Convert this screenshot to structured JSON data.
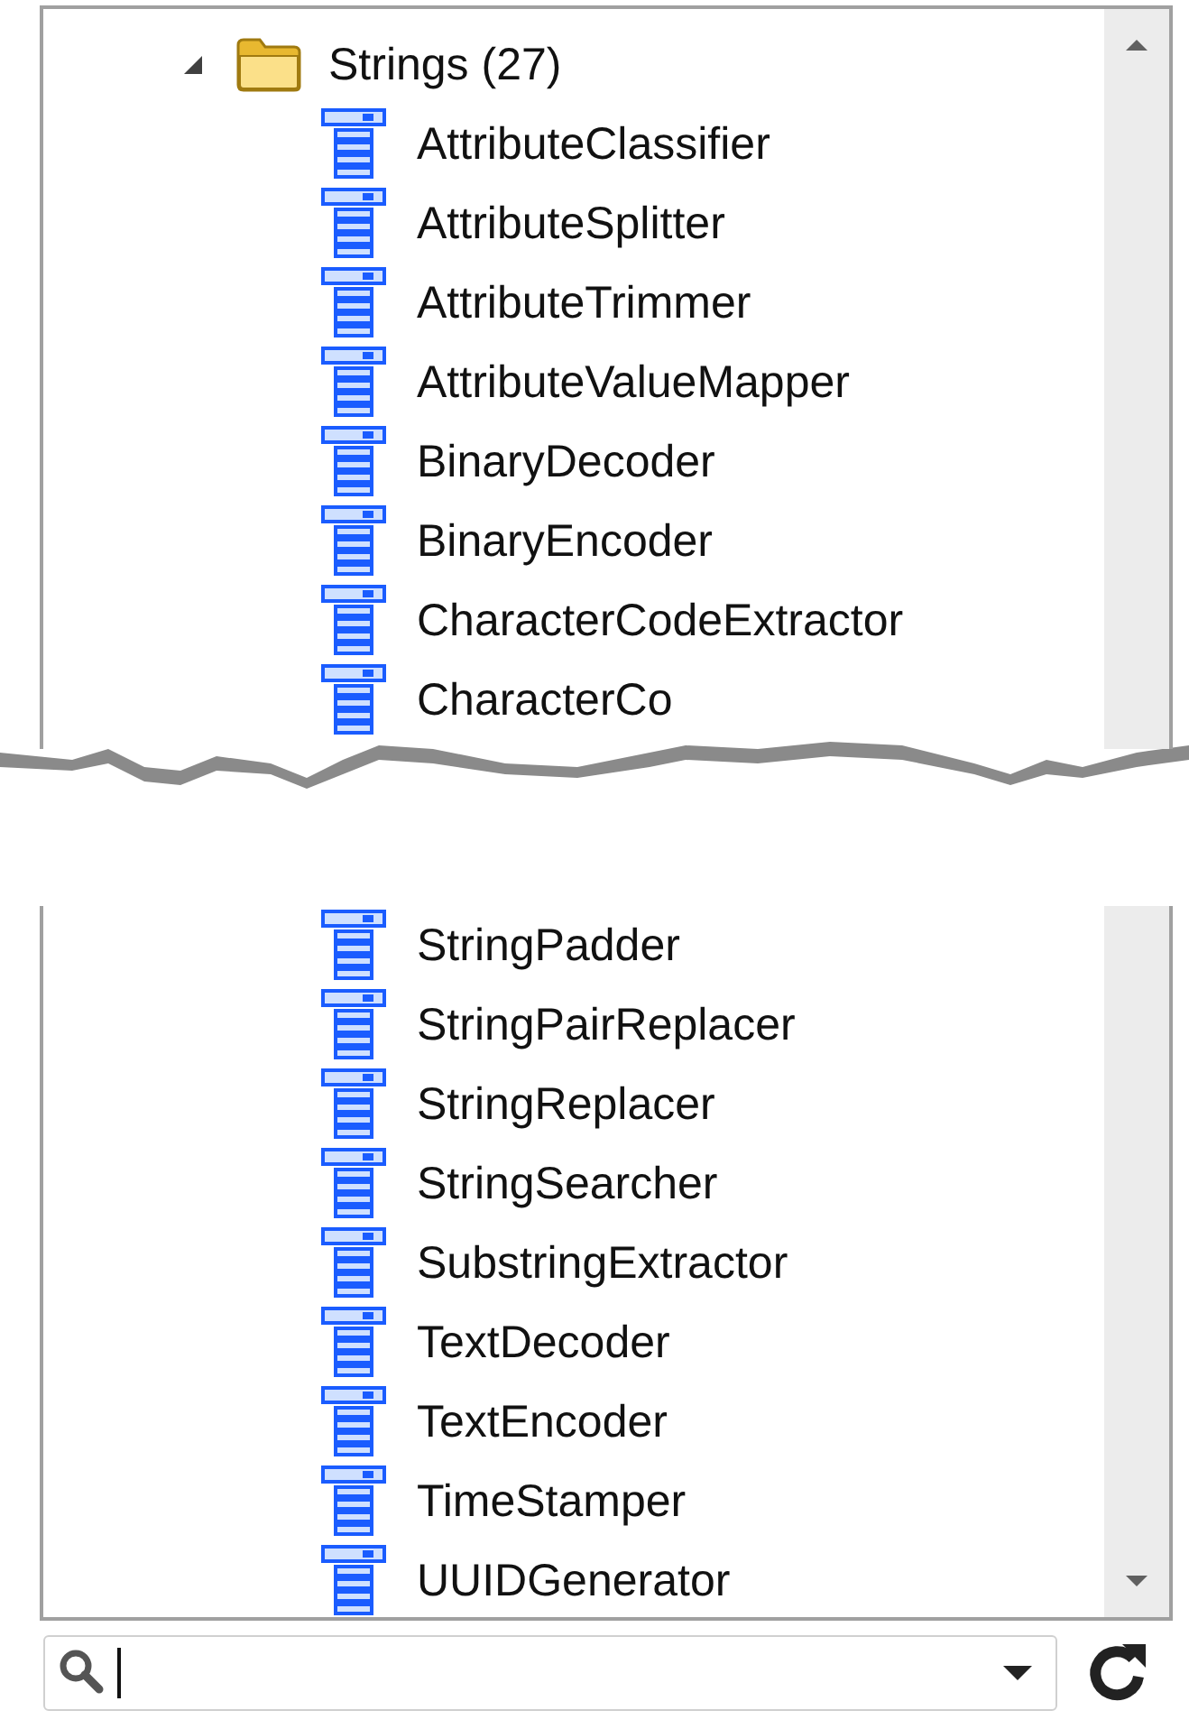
{
  "tree": {
    "items": [
      {
        "label": "Strings (27)",
        "expanded": true,
        "children": [
          {
            "kind": "transformer",
            "label": "AttributeClassifier"
          },
          {
            "kind": "transformer",
            "label": "AttributeSplitter"
          },
          {
            "kind": "transformer",
            "label": "AttributeTrimmer"
          },
          {
            "kind": "transformer",
            "label": "AttributeValueMapper"
          },
          {
            "kind": "transformer",
            "label": "BinaryDecoder"
          },
          {
            "kind": "transformer",
            "label": "BinaryEncoder"
          },
          {
            "kind": "transformer",
            "label": "CharacterCodeExtractor"
          },
          {
            "kind": "transformer",
            "label": "CharacterCo"
          },
          {
            "kind": "tear"
          },
          {
            "kind": "transformer",
            "label": "StringPadder"
          },
          {
            "kind": "transformer",
            "label": "StringPairReplacer"
          },
          {
            "kind": "transformer",
            "label": "StringReplacer"
          },
          {
            "kind": "transformer",
            "label": "StringSearcher"
          },
          {
            "kind": "transformer",
            "label": "SubstringExtractor"
          },
          {
            "kind": "transformer",
            "label": "TextDecoder"
          },
          {
            "kind": "transformer",
            "label": "TextEncoder"
          },
          {
            "kind": "transformer",
            "label": "TimeStamper"
          },
          {
            "kind": "transformer",
            "label": "UUIDGenerator"
          }
        ]
      }
    ]
  },
  "search": {
    "focused": true
  }
}
